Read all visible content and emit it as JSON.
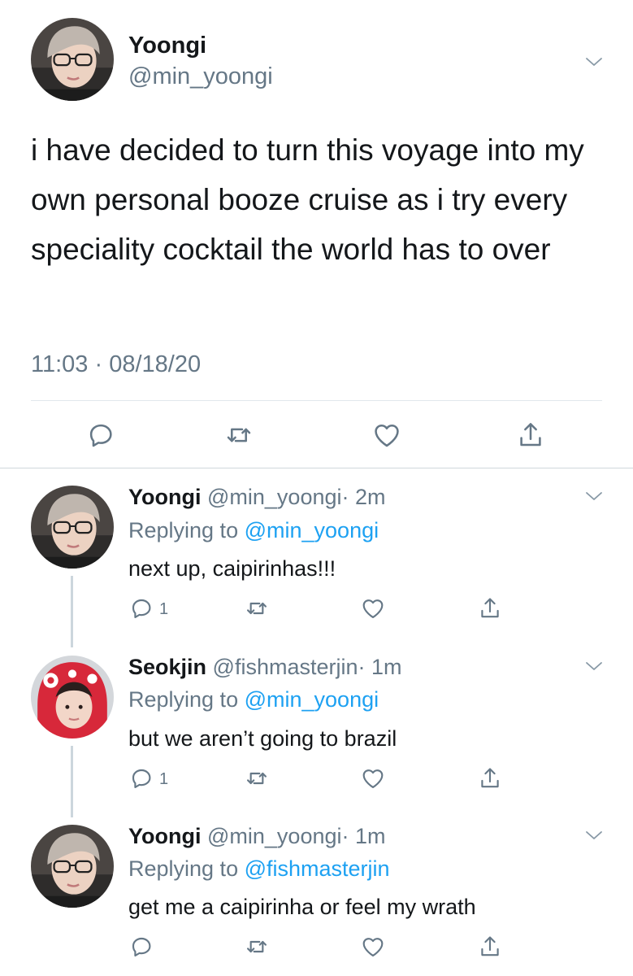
{
  "main_tweet": {
    "author_name": "Yoongi",
    "author_handle": "@min_yoongi",
    "text": "i have decided to turn this voyage into my own personal booze cruise as i try every speciality cocktail the world has to over",
    "timestamp": "11:03 · 08/18/20",
    "avatar": "avatar-yoongi",
    "actions": [
      "reply-icon",
      "retweet-icon",
      "like-icon",
      "share-icon"
    ]
  },
  "replies": [
    {
      "author_name": "Yoongi",
      "author_handle": "@min_yoongi",
      "time": "· 2m",
      "replying_prefix": "Replying to",
      "replying_to": "@min_yoongi",
      "text": "next up, caipirinhas!!!",
      "reply_count": "1",
      "avatar": "avatar-yoongi"
    },
    {
      "author_name": "Seokjin",
      "author_handle": "@fishmasterjin",
      "time": "· 1m",
      "replying_prefix": "Replying to",
      "replying_to": "@min_yoongi",
      "text": "but we aren’t going to brazil",
      "reply_count": "1",
      "avatar": "avatar-seokjin"
    },
    {
      "author_name": "Yoongi",
      "author_handle": "@min_yoongi",
      "time": "· 1m",
      "replying_prefix": "Replying to",
      "replying_to": "@fishmasterjin",
      "text": "get me a caipirinha or feel my wrath",
      "reply_count": "",
      "avatar": "avatar-yoongi"
    }
  ],
  "colors": {
    "text": "#14171a",
    "secondary": "#657786",
    "link": "#1da1f2",
    "divider": "#e1e8ed",
    "thread_line": "#ccd6dd"
  }
}
